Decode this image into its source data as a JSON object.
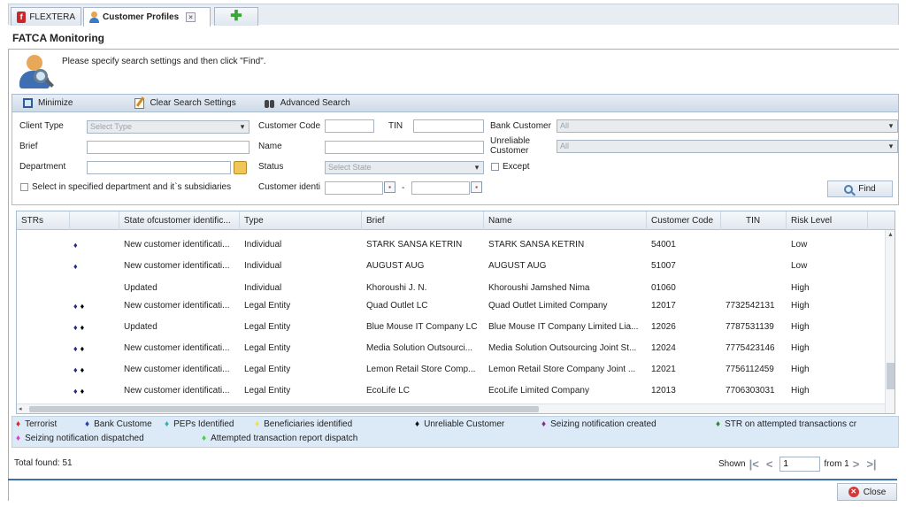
{
  "tabs": [
    {
      "label": "FLEXTERA",
      "icon": "flextera-logo-icon"
    },
    {
      "label": "Customer Profiles",
      "icon": "user-icon",
      "active": true
    },
    {
      "label": "",
      "icon": "plus-icon"
    }
  ],
  "page_title": "FATCA Monitoring",
  "hint": "Please specify search settings and then click \"Find\".",
  "toolbar": {
    "minimize": "Minimize",
    "clear": "Clear Search Settings",
    "advanced": "Advanced Search"
  },
  "form": {
    "client_type_label": "Client Type",
    "client_type_value": "Select Type",
    "brief_label": "Brief",
    "department_label": "Department",
    "subsidiaries_label": "Select in specified department and it`s subsidiaries",
    "customer_code_label": "Customer Code",
    "tin_label": "TIN",
    "name_label": "Name",
    "status_label": "Status",
    "status_value": "Select State",
    "customer_ident_label": "Customer identi",
    "date_sep": "-",
    "bank_customer_label": "Bank Customer",
    "bank_customer_value": "All",
    "unreliable_label_1": "Unreliable",
    "unreliable_label_2": "Customer",
    "unreliable_value": "All",
    "except_label": "Except",
    "find": "Find"
  },
  "grid": {
    "columns": [
      "STRs",
      "",
      "State ofcustomer identific...",
      "Type",
      "Brief",
      "Name",
      "Customer Code",
      "TIN",
      "Risk Level"
    ],
    "rows": [
      {
        "marks": "♦",
        "marks_color": "blue",
        "state": "New customer identificati...",
        "type": "Individual",
        "brief": "STARK SANSA KETRIN",
        "name": "STARK SANSA KETRIN",
        "code": "54001",
        "tin": "",
        "risk": "Low"
      },
      {
        "marks": "♦",
        "marks_color": "blue",
        "state": "New customer identificati...",
        "type": "Individual",
        "brief": "AUGUST AUG",
        "name": "AUGUST AUG",
        "code": "51007",
        "tin": "",
        "risk": "Low"
      },
      {
        "marks": "",
        "marks_color": "blue",
        "state": "Updated",
        "type": "Individual",
        "brief": "Khoroushi J. N.",
        "name": "Khoroushi Jamshed Nima",
        "code": "01060",
        "tin": "",
        "risk": "High"
      },
      {
        "marks": "♦♦",
        "marks_color": "mixed",
        "state": "New customer identificati...",
        "type": "Legal Entity",
        "brief": "Quad Outlet LC",
        "name": "Quad Outlet Limited Company",
        "code": "12017",
        "tin": "7732542131",
        "risk": "High"
      },
      {
        "marks": "♦♦",
        "marks_color": "mixed",
        "state": "Updated",
        "type": "Legal Entity",
        "brief": "Blue Mouse IT Company LC",
        "name": "Blue Mouse IT Company Limited Lia...",
        "code": "12026",
        "tin": "7787531139",
        "risk": "High"
      },
      {
        "marks": "♦♦",
        "marks_color": "mixed",
        "state": "New customer identificati...",
        "type": "Legal Entity",
        "brief": "Media Solution Outsourci...",
        "name": "Media Solution Outsourcing Joint St...",
        "code": "12024",
        "tin": "7775423146",
        "risk": "High"
      },
      {
        "marks": "♦♦",
        "marks_color": "mixed",
        "state": "New customer identificati...",
        "type": "Legal Entity",
        "brief": "Lemon Retail Store Comp...",
        "name": "Lemon Retail Store Company Joint ...",
        "code": "12021",
        "tin": "7756112459",
        "risk": "High"
      },
      {
        "marks": "♦♦",
        "marks_color": "mixed",
        "state": "New customer identificati...",
        "type": "Legal Entity",
        "brief": "EcoLife LC",
        "name": "EcoLife Limited Company",
        "code": "12013",
        "tin": "7706303031",
        "risk": "High"
      }
    ]
  },
  "legend": [
    {
      "label": "Terrorist",
      "color": "#d42a2a"
    },
    {
      "label": "Bank Custome",
      "color": "#1d3fb8"
    },
    {
      "label": "PEPs Identified",
      "color": "#27b6b6"
    },
    {
      "label": "Beneficiaries identified",
      "color": "#f2e33a"
    },
    {
      "label": "Unreliable Customer",
      "color": "#111111"
    },
    {
      "label": "Seizing notification created",
      "color": "#8a2a8a"
    },
    {
      "label": "STR on attempted transactions cr",
      "color": "#2a8a2a"
    },
    {
      "label": "Seizing notification dispatched",
      "color": "#e03adf"
    },
    {
      "label": "Attempted transaction report dispatch",
      "color": "#3ad83a"
    }
  ],
  "footer": {
    "total": "Total found: 51",
    "shown": "Shown",
    "page": "1",
    "from": "from 1",
    "close": "Close"
  }
}
